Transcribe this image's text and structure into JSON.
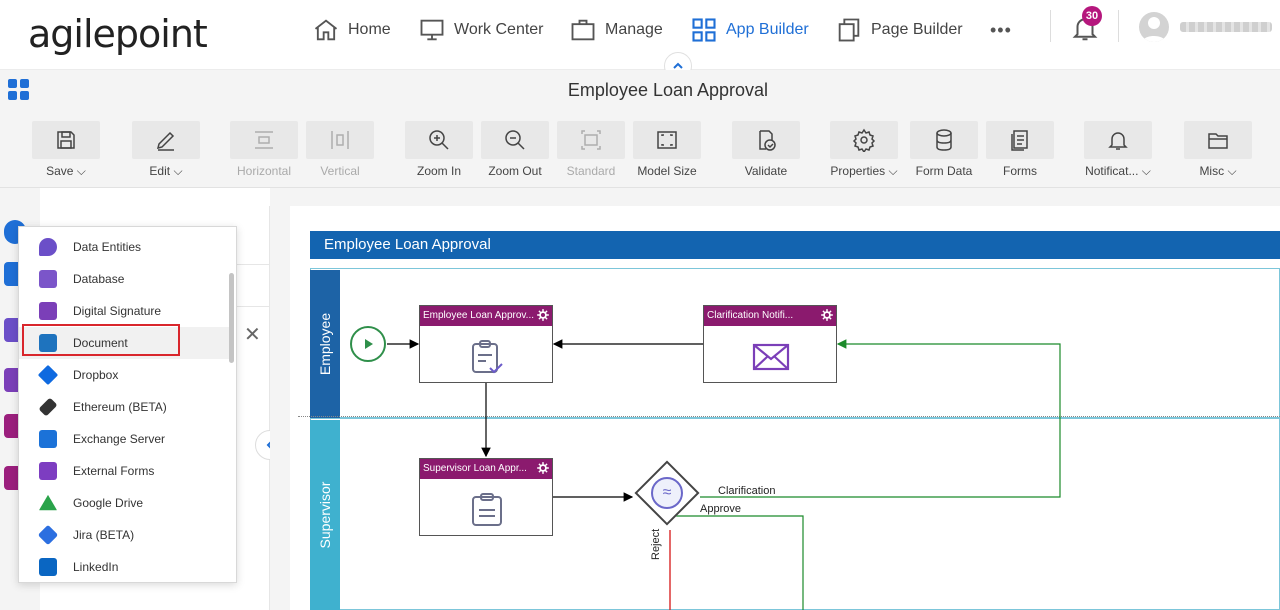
{
  "brand": {
    "logo_text": "agilepoint"
  },
  "nav": {
    "items": [
      {
        "label": "Home",
        "icon": "home-icon"
      },
      {
        "label": "Work Center",
        "icon": "monitor-icon"
      },
      {
        "label": "Manage",
        "icon": "briefcase-icon"
      },
      {
        "label": "App Builder",
        "icon": "grid-icon",
        "active": true
      },
      {
        "label": "Page Builder",
        "icon": "pages-icon"
      }
    ],
    "more": "•••",
    "notifications_count": "30"
  },
  "app": {
    "title": "Employee Loan Approval"
  },
  "toolbar": {
    "tools": [
      {
        "label": "Save",
        "dropdown": true
      },
      {
        "label": "Edit",
        "dropdown": true
      },
      {
        "label": "Horizontal",
        "disabled": true
      },
      {
        "label": "Vertical",
        "disabled": true
      },
      {
        "label": "Zoom In"
      },
      {
        "label": "Zoom Out"
      },
      {
        "label": "Standard",
        "disabled": true
      },
      {
        "label": "Model Size"
      },
      {
        "label": "Validate"
      },
      {
        "label": "Properties",
        "dropdown": true
      },
      {
        "label": "Form Data"
      },
      {
        "label": "Forms"
      },
      {
        "label": "Notificat...",
        "dropdown": true
      },
      {
        "label": "Misc",
        "dropdown": true
      }
    ]
  },
  "dropdown": {
    "items": [
      {
        "label": "Data Entities",
        "color": "#6b4fc8"
      },
      {
        "label": "Database",
        "color": "#7b55c9"
      },
      {
        "label": "Digital Signature",
        "color": "#7b3fb8"
      },
      {
        "label": "Document",
        "color": "#1e73be",
        "selected": true
      },
      {
        "label": "Dropbox",
        "color": "#0f6ae0"
      },
      {
        "label": "Ethereum (BETA)",
        "color": "#333333"
      },
      {
        "label": "Exchange Server",
        "color": "#1b72d8"
      },
      {
        "label": "External Forms",
        "color": "#7d3dc1"
      },
      {
        "label": "Google Drive",
        "color": "#2aa34a"
      },
      {
        "label": "Jira (BETA)",
        "color": "#2c6fe0"
      },
      {
        "label": "LinkedIn",
        "color": "#0a66c2"
      }
    ]
  },
  "diagram": {
    "process_title": "Employee Loan Approval",
    "lanes": [
      "Employee",
      "Supervisor"
    ],
    "tasks": [
      {
        "label": "Employee Loan Approv...",
        "icon": "form-check-icon"
      },
      {
        "label": "Clarification Notifi...",
        "icon": "envelope-icon"
      },
      {
        "label": "Supervisor Loan Appr...",
        "icon": "form-icon"
      }
    ],
    "flows": {
      "clarification": "Clarification",
      "approve": "Approve",
      "reject": "Reject"
    }
  }
}
